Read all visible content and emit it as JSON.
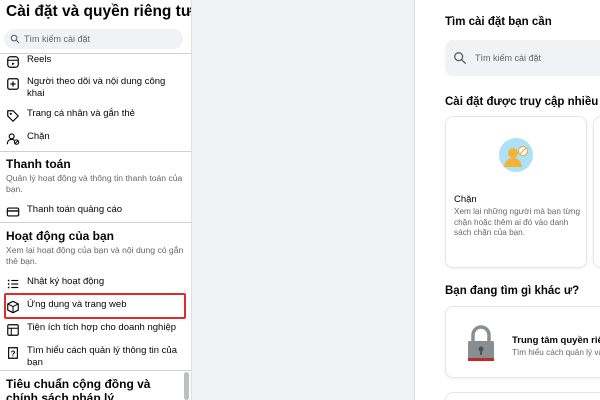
{
  "sidebar": {
    "title": "Cài đặt và quyền riêng tư",
    "search_placeholder": "Tìm kiếm cài đặt",
    "items_top": [
      {
        "label": "Reels",
        "icon": "reels-icon"
      },
      {
        "label": "Người theo dõi và nội dung công khai",
        "icon": "add-box-icon"
      },
      {
        "label": "Trang cá nhân và gắn thẻ",
        "icon": "tag-icon"
      },
      {
        "label": "Chặn",
        "icon": "block-user-icon"
      }
    ],
    "payments": {
      "heading": "Thanh toán",
      "description": "Quản lý hoạt động và thông tin thanh toán của bạn.",
      "items": [
        {
          "label": "Thanh toán quảng cáo",
          "icon": "credit-card-icon"
        }
      ]
    },
    "activity": {
      "heading": "Hoạt động của bạn",
      "description": "Xem lại hoạt động của bạn và nội dung có gắn thẻ bạn.",
      "items": [
        {
          "label": "Nhật ký hoạt động",
          "icon": "list-icon"
        },
        {
          "label": "Ứng dụng và trang web",
          "icon": "cube-icon"
        },
        {
          "label": "Tiện ích tích hợp cho doanh nghiệp",
          "icon": "puzzle-icon"
        },
        {
          "label": "Tìm hiểu cách quản lý thông tin của bạn",
          "icon": "info-icon"
        }
      ]
    },
    "community": {
      "heading": "Tiêu chuẩn cộng đồng và chính sách pháp lý"
    }
  },
  "main": {
    "search_heading": "Tìm cài đặt bạn cần",
    "search_placeholder": "Tìm kiếm cài đặt",
    "frequent_heading": "Cài đặt được truy cập nhiều nh",
    "block_card": {
      "title": "Chặn",
      "description": "Xem lại những người mà bạn từng chặn hoặc thêm ai đó vào danh sách chặn của bạn."
    },
    "other_heading": "Bạn đang tìm gì khác ư?",
    "privacy_card": {
      "title": "Trung tâm quyền riêng",
      "description": "Tìm hiểu cách quản lý và ki"
    }
  },
  "colors": {
    "highlight_border": "#e02b2b",
    "page_bg": "#f0f2f5",
    "block_avatar_bg": "#aee1f5",
    "block_person": "#f5b335",
    "lock_body": "#8a8d91",
    "lock_accent": "#c62828"
  }
}
